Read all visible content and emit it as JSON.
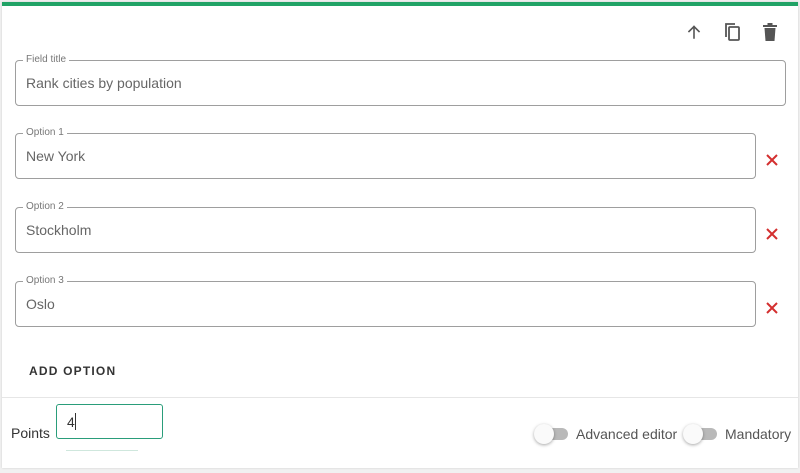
{
  "accent_color": "#21a366",
  "error_color": "#d32f2f",
  "toolbar": {
    "icons": [
      "arrow-up-icon",
      "copy-icon",
      "trash-icon"
    ]
  },
  "field_title": {
    "legend": "Field title",
    "value": "Rank cities by population"
  },
  "options": [
    {
      "legend": "Option 1",
      "value": "New York"
    },
    {
      "legend": "Option 2",
      "value": "Stockholm"
    },
    {
      "legend": "Option 3",
      "value": "Oslo"
    }
  ],
  "add_option_label": "ADD OPTION",
  "points": {
    "label": "Points",
    "value": "4"
  },
  "toggles": {
    "advanced_editor": {
      "label": "Advanced editor",
      "on": false
    },
    "mandatory": {
      "label": "Mandatory",
      "on": false
    }
  }
}
